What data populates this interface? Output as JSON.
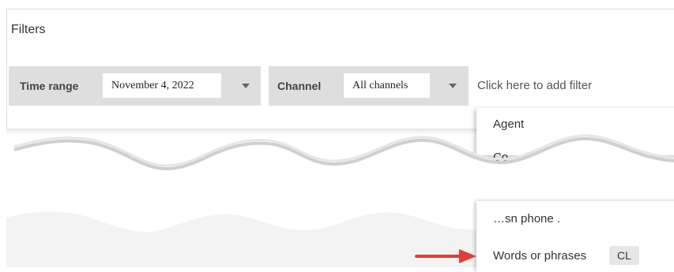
{
  "panel": {
    "title": "Filters"
  },
  "filters": {
    "time_range": {
      "label": "Time range",
      "value": "November 4, 2022"
    },
    "channel": {
      "label": "Channel",
      "value": "All channels"
    },
    "add_filter": "Click here to add filter"
  },
  "menu": {
    "items": [
      {
        "label": "Agent"
      },
      {
        "label": "Co"
      },
      {
        "label": "…sn phone ."
      },
      {
        "label": "Words or phrases",
        "shortcut": "CL"
      }
    ]
  },
  "colors": {
    "arrow": "#e03c3c",
    "filter_bar": "#dedede"
  }
}
